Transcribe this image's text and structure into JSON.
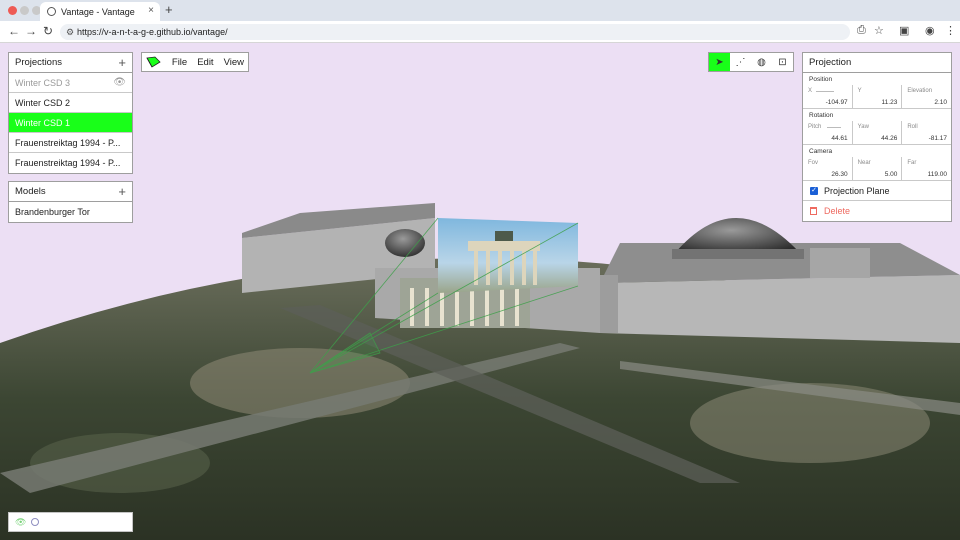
{
  "browser": {
    "tab_title": "Vantage - Vantage",
    "tab_close": "×",
    "new_tab": "+",
    "url": "https://v-a-n-t-a-g-e.github.io/vantage/",
    "nav": {
      "back": "←",
      "forward": "→",
      "reload": "↻"
    }
  },
  "projections": {
    "title": "Projections",
    "add": "+",
    "items": [
      {
        "label": "Winter CSD 3",
        "state": "dim"
      },
      {
        "label": "Winter CSD 2",
        "state": "normal"
      },
      {
        "label": "Winter CSD 1",
        "state": "active"
      },
      {
        "label": "Frauenstreiktag 1994 - P...",
        "state": "normal"
      },
      {
        "label": "Frauenstreiktag 1994 - P...",
        "state": "normal"
      }
    ]
  },
  "models": {
    "title": "Models",
    "add": "+",
    "items": [
      {
        "label": "Brandenburger Tor"
      }
    ]
  },
  "menu": {
    "file": "File",
    "edit": "Edit",
    "view": "View"
  },
  "toolbar": {
    "tools": [
      {
        "icon": "cursor-icon",
        "glyph": "➤",
        "active": true
      },
      {
        "icon": "nodes-icon",
        "glyph": "⋰",
        "active": false
      },
      {
        "icon": "globe-icon",
        "glyph": "◍",
        "active": false
      },
      {
        "icon": "focus-icon",
        "glyph": "⊡",
        "active": false
      }
    ]
  },
  "inspector": {
    "title": "Projection",
    "position": {
      "label": "Position",
      "x_label": "X",
      "x": "-104.97",
      "y_label": "Y",
      "y": "11.23",
      "z_label": "Elevation",
      "z": "2.10"
    },
    "rotation": {
      "label": "Rotation",
      "pitch_label": "Pitch",
      "pitch": "44.61",
      "yaw_label": "Yaw",
      "yaw": "44.26",
      "roll_label": "Roll",
      "roll": "-81.17"
    },
    "camera": {
      "label": "Camera",
      "fov_label": "Fov",
      "fov": "26.30",
      "near_label": "Near",
      "near": "5.00",
      "far_label": "Far",
      "far": "119.00"
    },
    "projection_plane": {
      "label": "Projection Plane",
      "checked": true
    },
    "delete_label": "Delete"
  },
  "colors": {
    "accent": "#19ff19",
    "delete": "#ee6a60",
    "checkbox": "#1a5fd6",
    "sky": "#ecdff4"
  }
}
